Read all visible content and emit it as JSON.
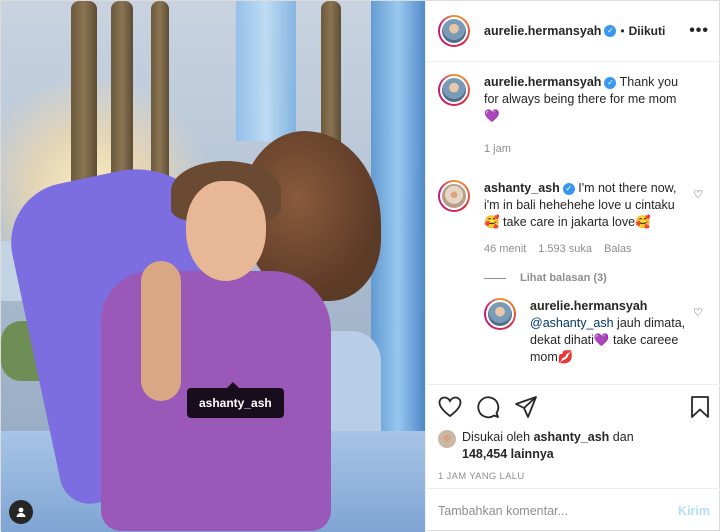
{
  "post": {
    "author": "aurelie.hermansyah",
    "follow_status": "Diikuti",
    "separator": "•",
    "more_label": "•••",
    "photo_tag": "ashanty_ash"
  },
  "caption": {
    "username": "aurelie.hermansyah",
    "text": "Thank you for always being there for me mom 💜",
    "time": "1 jam"
  },
  "comments": [
    {
      "username": "ashanty_ash",
      "text": "I'm not there now, i'm in bali hehehehe love u cintaku🥰 take care in jakarta love🥰",
      "time": "46 menit",
      "likes": "1.593 suka",
      "reply_label": "Balas"
    }
  ],
  "view_replies": "Lihat balasan (3)",
  "reply": {
    "username": "aurelie.hermansyah",
    "mention": "@ashanty_ash",
    "text": " jauh dimata, dekat dihati💜 take careee mom💋"
  },
  "likes": {
    "prefix": "Disukai oleh",
    "user": "ashanty_ash",
    "conj": "dan",
    "count": "148,454 lainnya"
  },
  "post_time": "1 JAM YANG LALU",
  "comment_input": {
    "placeholder": "Tambahkan komentar...",
    "submit": "Kirim"
  },
  "icons": [
    "heart-icon",
    "comment-icon",
    "share-icon",
    "bookmark-icon",
    "user-tag-icon",
    "verified-icon",
    "more-icon"
  ],
  "colors": {
    "verified": "#3897f0",
    "link": "#00376b",
    "muted": "#8e8e8e",
    "post_disabled": "#b2dffc"
  }
}
